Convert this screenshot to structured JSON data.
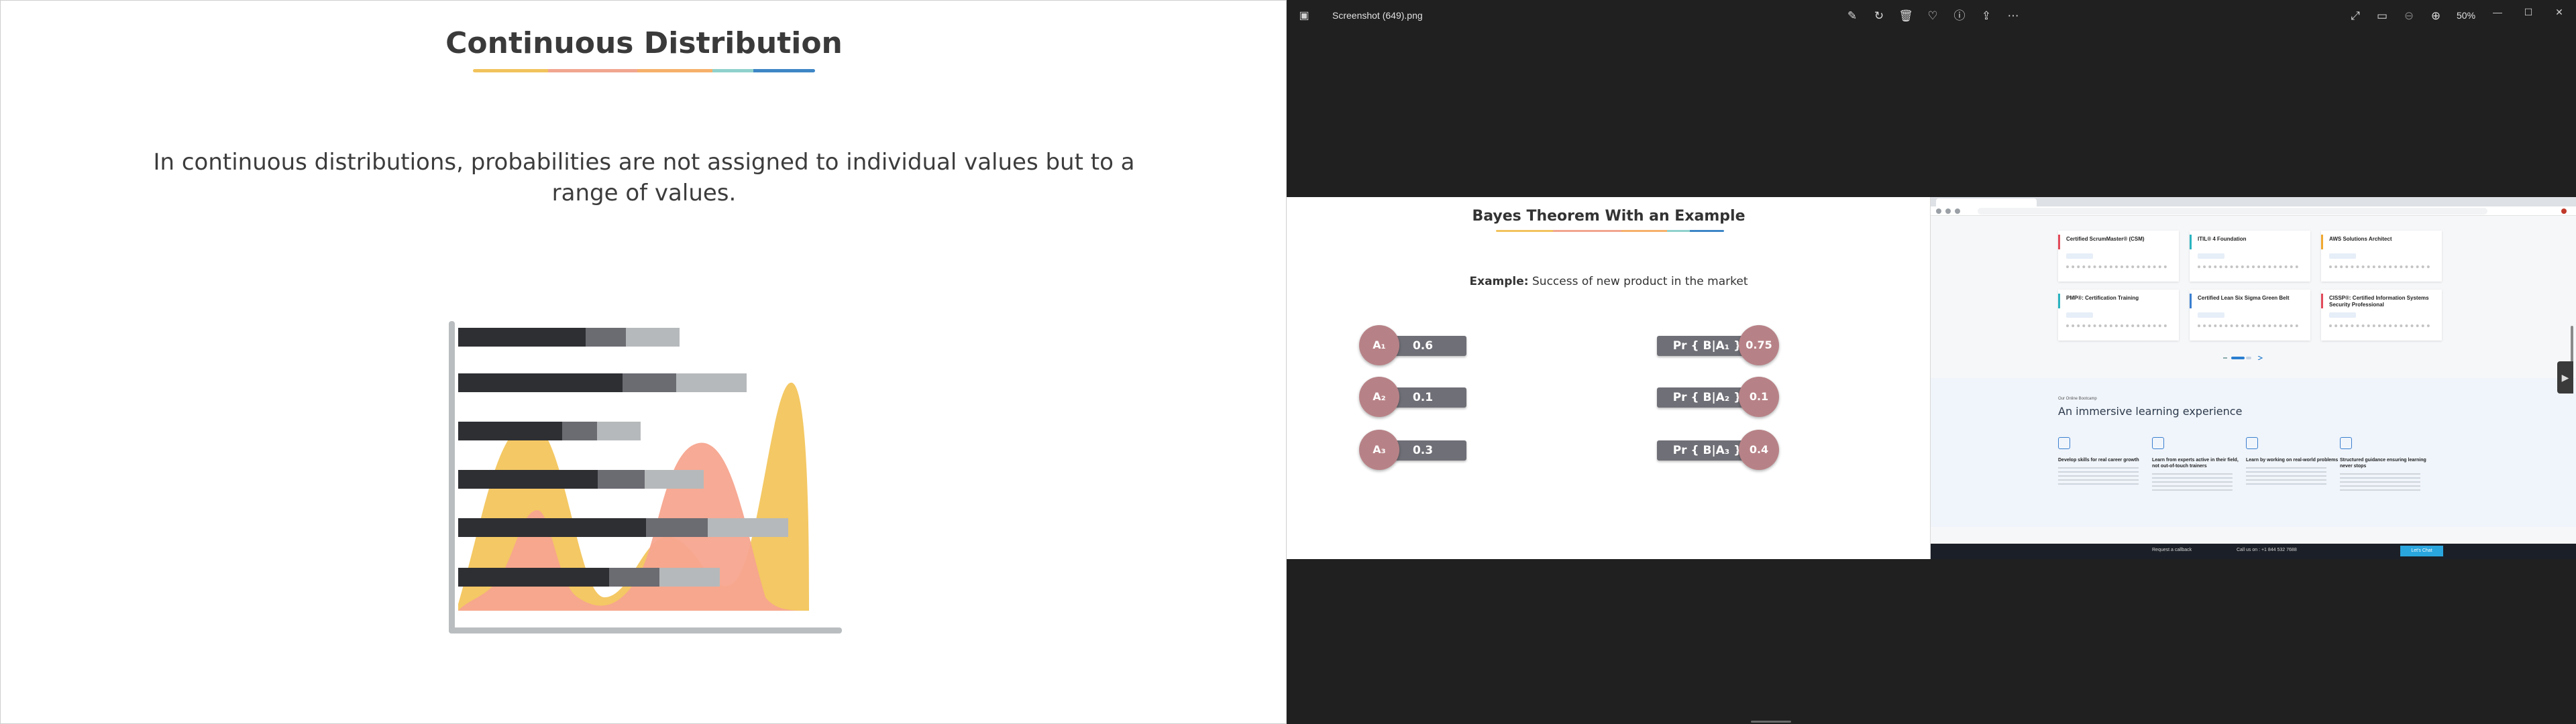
{
  "slide": {
    "title": "Continuous Distribution",
    "body": "In continuous distributions, probabilities are not assigned to individual values but to a range of values."
  },
  "viewer": {
    "filename": "Screenshot (649).png",
    "zoom": "50%",
    "toolbar_icons": [
      "edit-icon",
      "rotate-icon",
      "delete-icon",
      "favorite-icon",
      "info-icon",
      "share-icon",
      "more-icon"
    ],
    "right_icons": [
      "fullscreen-icon",
      "slideshow-icon",
      "zoom-out-icon",
      "zoom-in-icon"
    ]
  },
  "bayes": {
    "title": "Bayes Theorem With an Example",
    "example_label": "Example:",
    "example_text": " Success of new product in the market",
    "priors": [
      {
        "label": "A₁",
        "value": "0.6"
      },
      {
        "label": "A₂",
        "value": "0.1"
      },
      {
        "label": "A₃",
        "value": "0.3"
      }
    ],
    "likelihoods": [
      {
        "label": "Pr { B|A₁ }",
        "value": "0.75"
      },
      {
        "label": "Pr { B|A₂ }",
        "value": "0.1"
      },
      {
        "label": "Pr { B|A₃ }",
        "value": "0.4"
      }
    ]
  },
  "browser": {
    "cards": [
      {
        "title": "Certified ScrumMaster® (CSM)",
        "accent": "#e24b5b"
      },
      {
        "title": "ITIL® 4 Foundation",
        "accent": "#2bb3c0"
      },
      {
        "title": "AWS Solutions Architect",
        "accent": "#f0a830"
      },
      {
        "title": "PMP®: Certification Training",
        "accent": "#2bb3c0"
      },
      {
        "title": "Certified Lean Six Sigma Green Belt",
        "accent": "#3a7fd0"
      },
      {
        "title": "CISSP®: Certified Information Systems Security Professional",
        "accent": "#e24b5b"
      }
    ],
    "section_small": "Our Online Bootcamp",
    "section_heading": "An immersive learning experience",
    "features": [
      "Develop skills for real career growth",
      "Learn from experts active in their field, not out-of-touch trainers",
      "Learn by working on real-world problems",
      "Structured guidance ensuring learning never stops"
    ],
    "footer": {
      "callback": "Request a callback",
      "call": "Call us on : +1 844 532 7688",
      "cta": "Let's Chat"
    }
  }
}
